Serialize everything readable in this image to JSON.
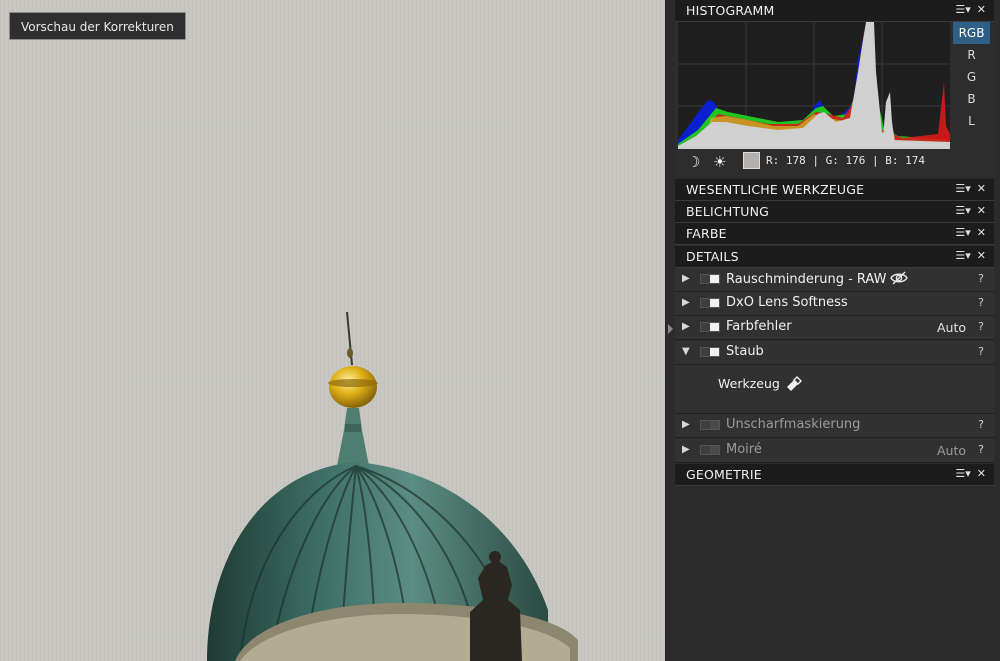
{
  "viewer": {
    "preview_button_label": "Vorschau der Korrekturen"
  },
  "histogram": {
    "title": "HISTOGRAMM",
    "channels": [
      "RGB",
      "R",
      "G",
      "B",
      "L"
    ],
    "active_channel": "RGB",
    "readout": "R: 178 | G: 176 | B: 174",
    "swatch_color": "#b2b0ae",
    "icons": [
      "moon-icon",
      "sun-icon"
    ]
  },
  "sections": {
    "essentials": "WESENTLICHE WERKZEUGE",
    "exposure": "BELICHTUNG",
    "color": "FARBE",
    "details": "DETAILS",
    "geometry": "GEOMETRIE"
  },
  "details_tools": [
    {
      "label": "Rauschminderung - RAW",
      "extra": "",
      "help": "?",
      "expanded": false,
      "enabled": true
    },
    {
      "label": "DxO Lens Softness",
      "extra": "",
      "help": "?",
      "expanded": false,
      "enabled": true
    },
    {
      "label": "Farbfehler",
      "extra": "Auto",
      "help": "?",
      "expanded": false,
      "enabled": true
    },
    {
      "label": "Staub",
      "extra": "",
      "help": "?",
      "expanded": true,
      "enabled": true
    },
    {
      "label": "Unscharfmaskierung",
      "extra": "",
      "help": "?",
      "expanded": false,
      "enabled": false
    },
    {
      "label": "Moiré",
      "extra": "Auto",
      "help": "?",
      "expanded": false,
      "enabled": false
    }
  ],
  "staub": {
    "tool_label": "Werkzeug"
  },
  "pane_controls": {
    "menu_glyph": "☰▾",
    "close_glyph": "✕"
  },
  "colors": {
    "panel_bg": "#2b2b2b",
    "header_bg": "#1c1c1c",
    "accent": "#2f5f86"
  }
}
